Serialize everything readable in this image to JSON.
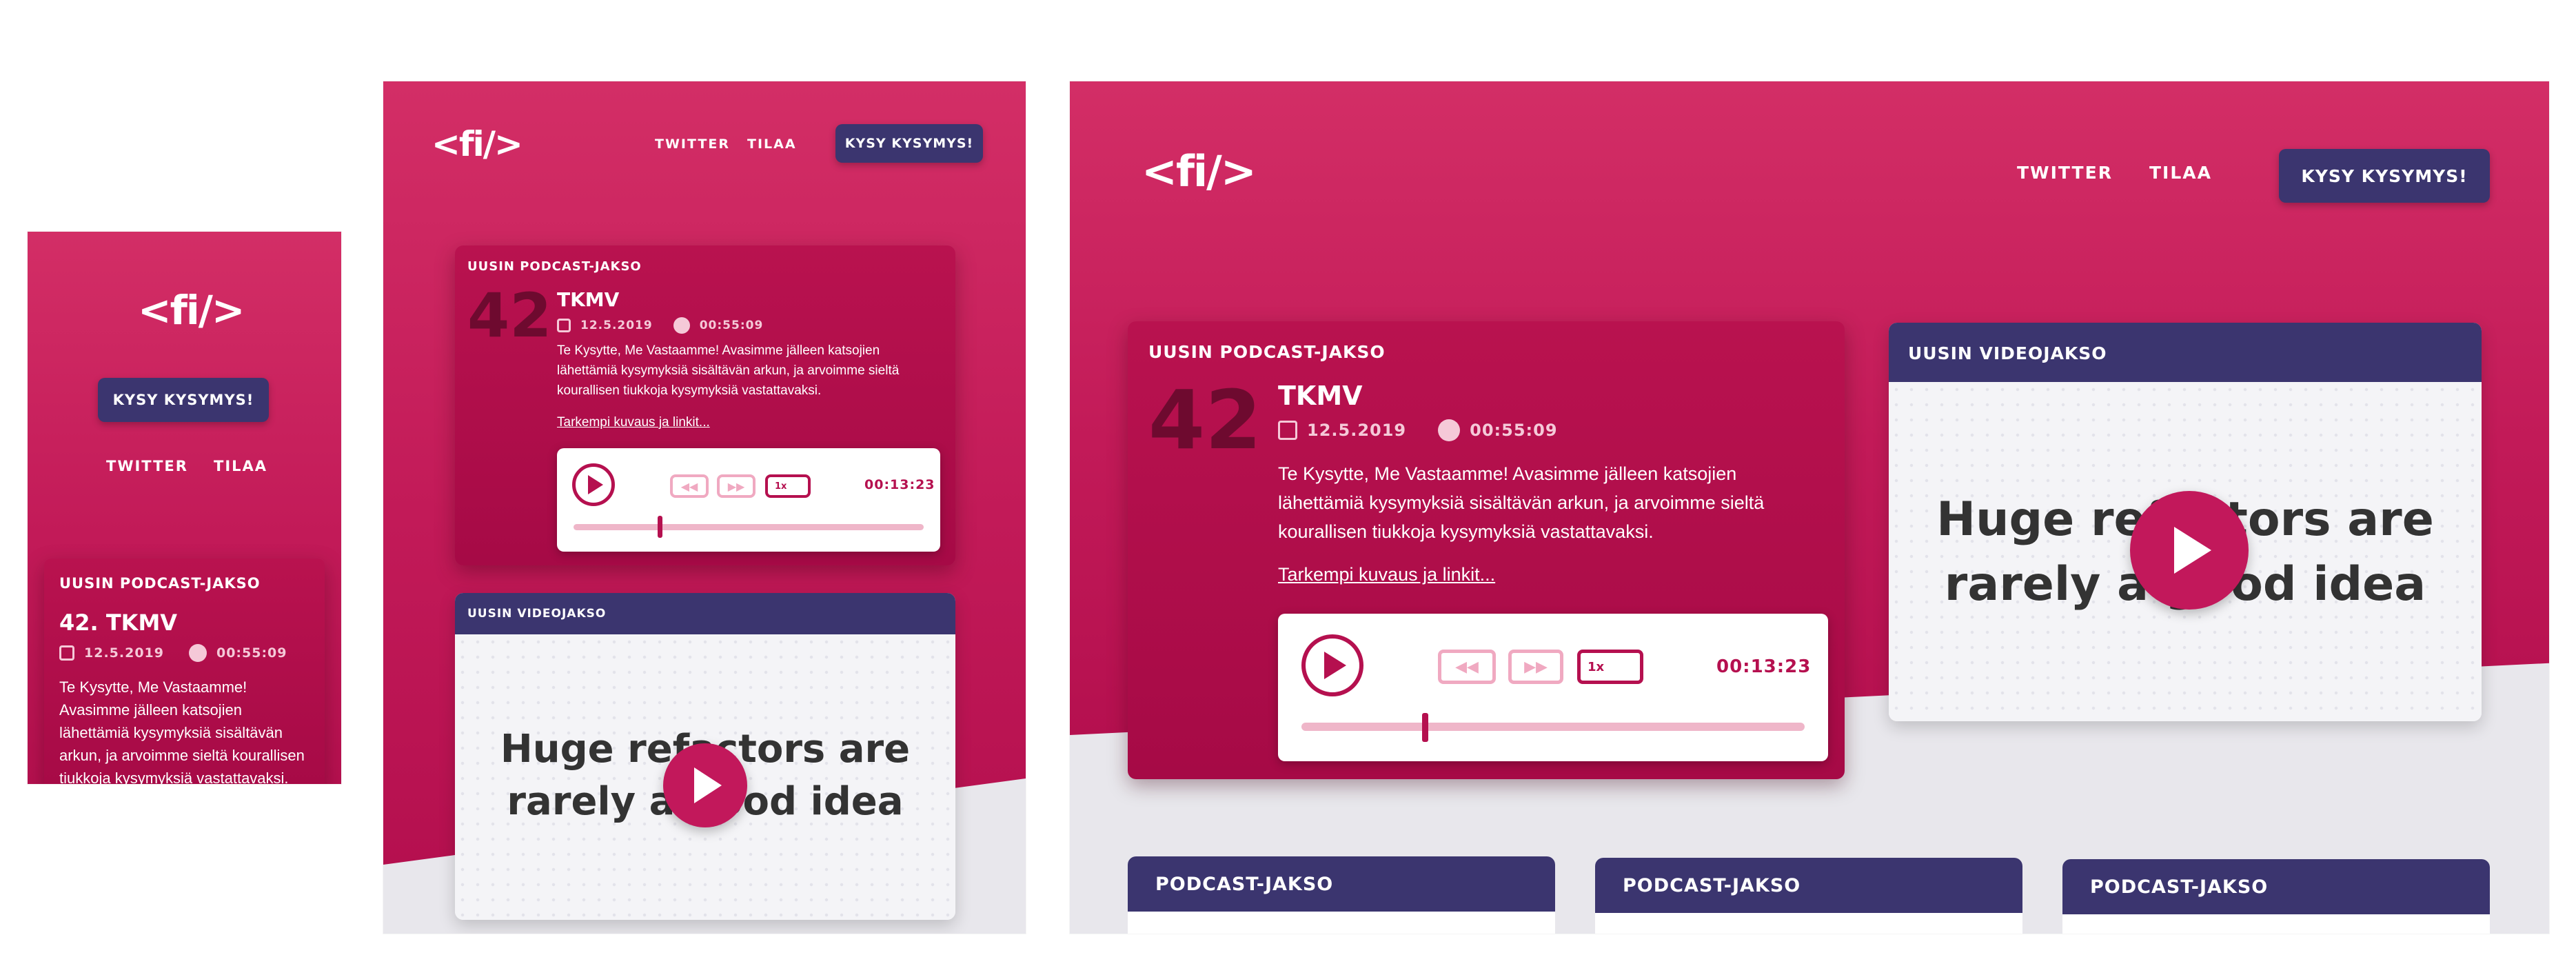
{
  "site": {
    "logo": "<fi/>"
  },
  "nav": {
    "twitter": "TWITTER",
    "subscribe": "TILAA",
    "ask": "KYSY KYSYMYS!"
  },
  "latest_podcast": {
    "label": "UUSIN PODCAST-JAKSO",
    "number": "42",
    "title": "TKMV",
    "mobile_title": "42. TKMV",
    "date": "12.5.2019",
    "duration": "00:55:09",
    "description": "Te Kysytte, Me Vastaamme! Avasimme jälleen katsojien lähettämiä kysymyksiä sisältävän arkun, ja arvoimme sieltä kourallisen tiukkoja kysymyksiä vastattavaksi.",
    "more_link": "Tarkempi kuvaus ja linkit...",
    "player": {
      "current_time": "00:13:23",
      "speed": "1x",
      "progress": 0.24
    }
  },
  "latest_video": {
    "label": "UUSIN VIDEOJAKSO",
    "label_small": "UUSIN VIDEOJAKSO",
    "line1": "Huge refactors are",
    "line2": "rarely a good idea"
  },
  "episode_list": {
    "items": [
      "PODCAST-JAKSO",
      "PODCAST-JAKSO",
      "PODCAST-JAKSO"
    ]
  },
  "colors": {
    "brand": "#c21a58",
    "navy": "#3b356f",
    "background": "#e8e7ec"
  }
}
